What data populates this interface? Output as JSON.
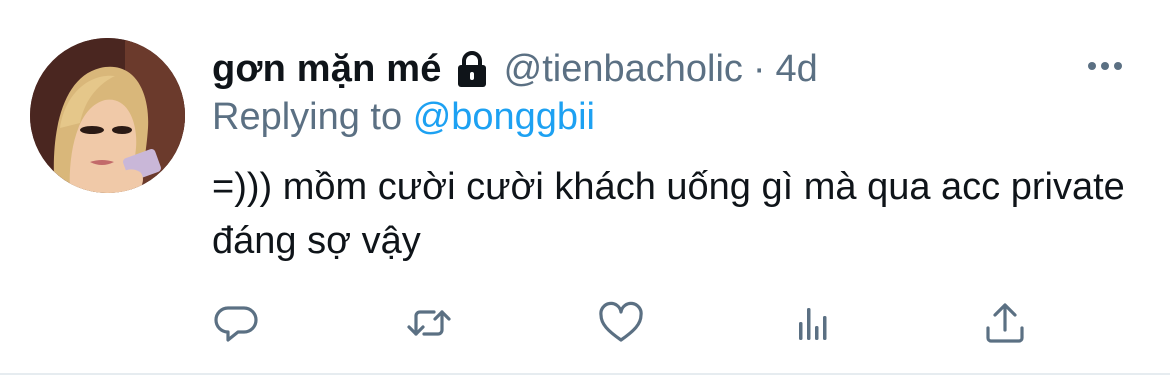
{
  "tweet": {
    "display_name": "gơn mặn mé",
    "handle": "@tienbacholic",
    "separator": "·",
    "time": "4d",
    "replying_prefix": "Replying to",
    "replying_to": "@bonggbii",
    "text": "=))) mồm cười cười khách uống gì mà qua acc private đáng sợ vậy",
    "protected_icon": "lock-icon",
    "more_icon": "more-horizontal-icon"
  },
  "actions": [
    {
      "icon": "reply-icon"
    },
    {
      "icon": "retweet-icon"
    },
    {
      "icon": "like-icon"
    },
    {
      "icon": "analytics-icon"
    },
    {
      "icon": "share-icon"
    }
  ],
  "colors": {
    "text": "#0f1419",
    "secondary": "#5b7083",
    "link": "#1da1f2",
    "divider": "#e6ecf0"
  }
}
